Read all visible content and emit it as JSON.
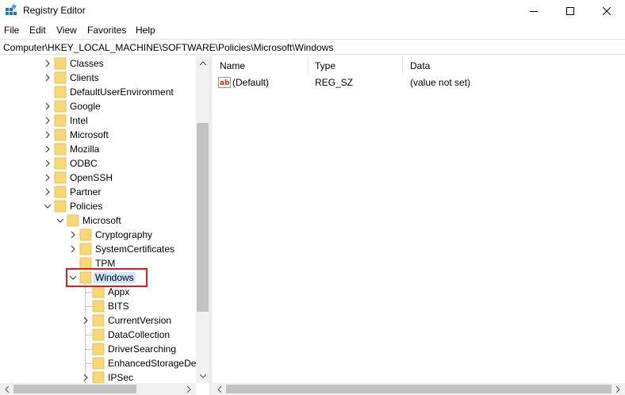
{
  "window": {
    "title": "Registry Editor"
  },
  "menu": [
    "File",
    "Edit",
    "View",
    "Favorites",
    "Help"
  ],
  "address": "Computer\\HKEY_LOCAL_MACHINE\\SOFTWARE\\Policies\\Microsoft\\Windows",
  "tree": [
    {
      "label": "Classes",
      "depth": 0,
      "chevron": "right"
    },
    {
      "label": "Clients",
      "depth": 0,
      "chevron": "right"
    },
    {
      "label": "DefaultUserEnvironment",
      "depth": 0,
      "chevron": "none"
    },
    {
      "label": "Google",
      "depth": 0,
      "chevron": "right"
    },
    {
      "label": "Intel",
      "depth": 0,
      "chevron": "right"
    },
    {
      "label": "Microsoft",
      "depth": 0,
      "chevron": "right"
    },
    {
      "label": "Mozilla",
      "depth": 0,
      "chevron": "right"
    },
    {
      "label": "ODBC",
      "depth": 0,
      "chevron": "right"
    },
    {
      "label": "OpenSSH",
      "depth": 0,
      "chevron": "right"
    },
    {
      "label": "Partner",
      "depth": 0,
      "chevron": "right"
    },
    {
      "label": "Policies",
      "depth": 0,
      "chevron": "down"
    },
    {
      "label": "Microsoft",
      "depth": 1,
      "chevron": "down"
    },
    {
      "label": "Cryptography",
      "depth": 2,
      "chevron": "right"
    },
    {
      "label": "SystemCertificates",
      "depth": 2,
      "chevron": "right"
    },
    {
      "label": "TPM",
      "depth": 2,
      "chevron": "none"
    },
    {
      "label": "Windows",
      "depth": 2,
      "chevron": "down",
      "selected": true
    },
    {
      "label": "Appx",
      "depth": 3,
      "chevron": "none"
    },
    {
      "label": "BITS",
      "depth": 3,
      "chevron": "none"
    },
    {
      "label": "CurrentVersion",
      "depth": 3,
      "chevron": "right"
    },
    {
      "label": "DataCollection",
      "depth": 3,
      "chevron": "none"
    },
    {
      "label": "DriverSearching",
      "depth": 3,
      "chevron": "none"
    },
    {
      "label": "EnhancedStorageDev",
      "depth": 3,
      "chevron": "none"
    },
    {
      "label": "IPSec",
      "depth": 3,
      "chevron": "right"
    }
  ],
  "list": {
    "columns": [
      "Name",
      "Type",
      "Data"
    ],
    "rows": [
      {
        "name": "(Default)",
        "type": "REG_SZ",
        "data": "(value not set)",
        "icon": "string-value-icon"
      }
    ]
  },
  "colors": {
    "selection": "#cce8ff",
    "highlight": "#e11b1b",
    "folder": "#f8d775"
  }
}
